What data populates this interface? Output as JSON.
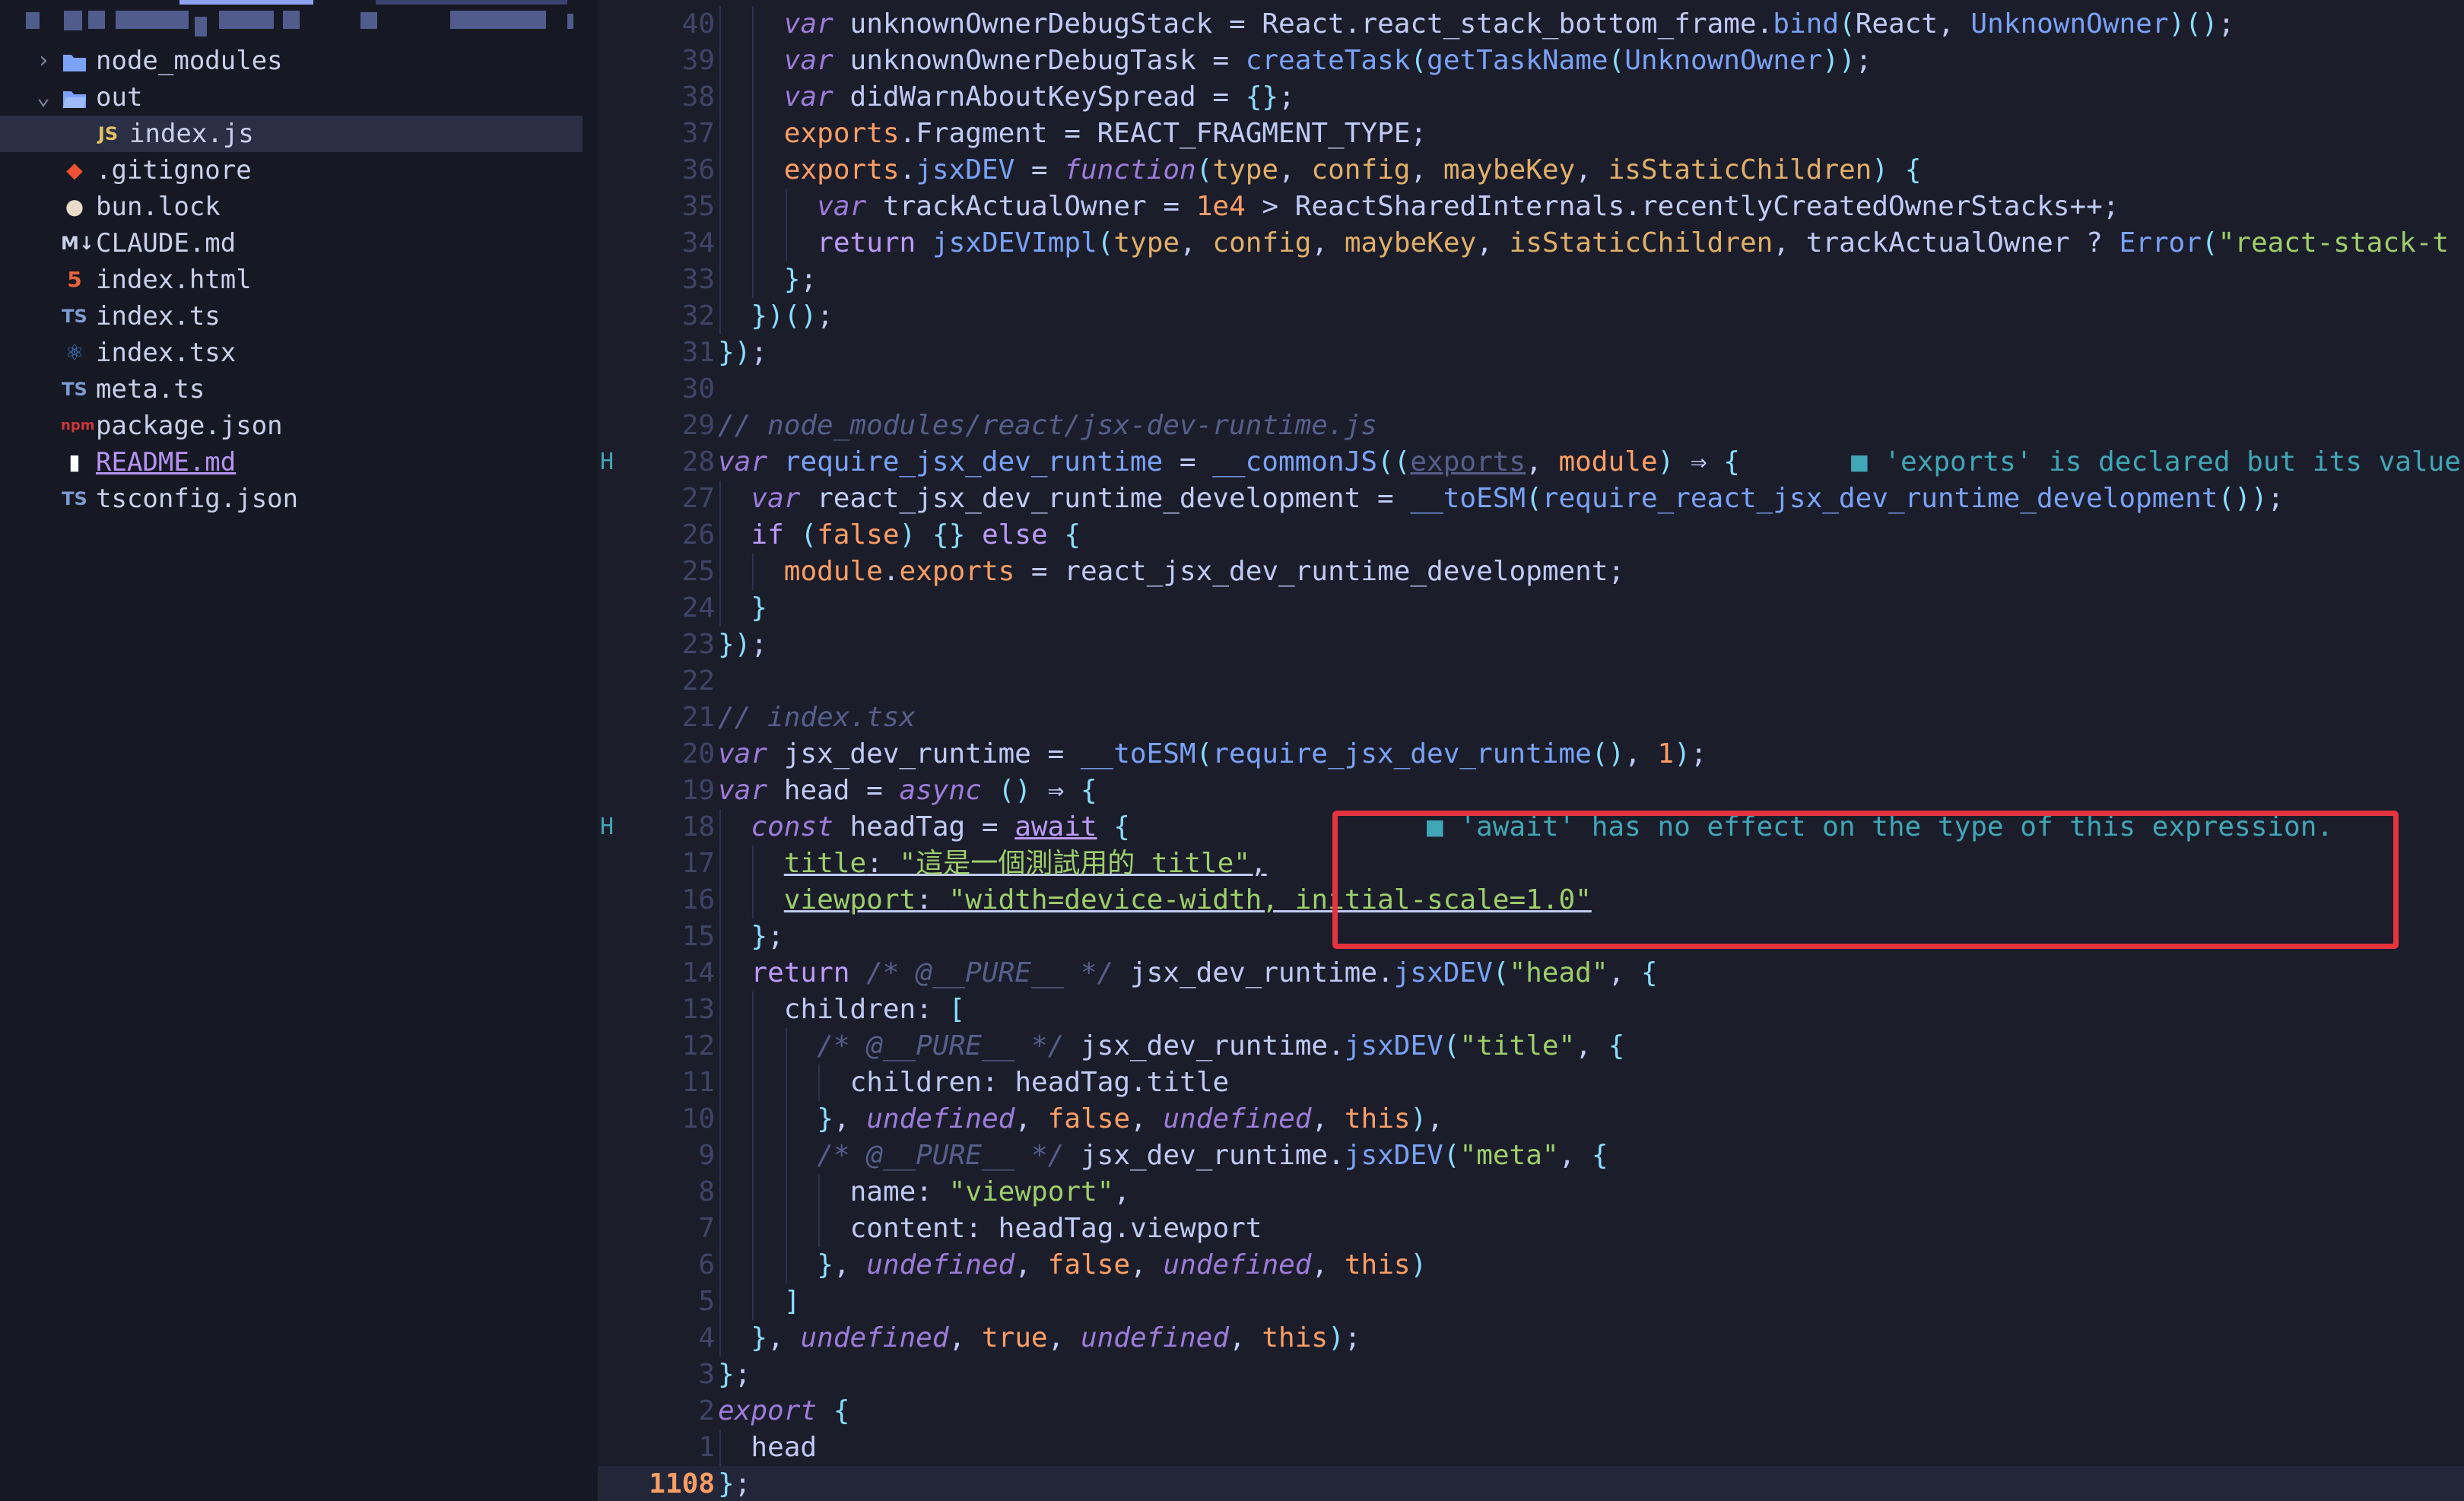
{
  "sidebar": {
    "items": [
      {
        "label": "node_modules",
        "icon": "folder-icon",
        "kind": "folder-closed"
      },
      {
        "label": "out",
        "icon": "folder-open-icon",
        "kind": "folder-open"
      },
      {
        "label": "index.js",
        "icon": "js-file-icon",
        "icon_text": "JS",
        "kind": "file",
        "active": true
      },
      {
        "label": ".gitignore",
        "icon": "git-icon",
        "icon_text": "◆",
        "kind": "file"
      },
      {
        "label": "bun.lock",
        "icon": "bun-icon",
        "icon_text": "●",
        "kind": "file"
      },
      {
        "label": "CLAUDE.md",
        "icon": "markdown-icon",
        "icon_text": "M↓",
        "kind": "file"
      },
      {
        "label": "index.html",
        "icon": "html5-icon",
        "icon_text": "5",
        "kind": "file"
      },
      {
        "label": "index.ts",
        "icon": "typescript-icon",
        "icon_text": "TS",
        "kind": "file"
      },
      {
        "label": "index.tsx",
        "icon": "react-icon",
        "icon_text": "⚛",
        "kind": "file"
      },
      {
        "label": "meta.ts",
        "icon": "typescript-icon",
        "icon_text": "TS",
        "kind": "file"
      },
      {
        "label": "package.json",
        "icon": "npm-icon",
        "icon_text": "npm",
        "kind": "file"
      },
      {
        "label": "README.md",
        "icon": "readme-icon",
        "icon_text": "▮",
        "kind": "file",
        "modified": true
      },
      {
        "label": "tsconfig.json",
        "icon": "tsconfig-icon",
        "icon_text": "TS",
        "kind": "file"
      }
    ]
  },
  "editor": {
    "lines": [
      {
        "num": "40",
        "code": "var unknownOwnerDebugStack = React.react_stack_bottom_frame.bind(React, UnknownOwner)();"
      },
      {
        "num": "39",
        "code": "var unknownOwnerDebugTask = createTask(getTaskName(UnknownOwner));"
      },
      {
        "num": "38",
        "code": "var didWarnAboutKeySpread = {};"
      },
      {
        "num": "37",
        "code": "exports.Fragment = REACT_FRAGMENT_TYPE;"
      },
      {
        "num": "36",
        "code": "exports.jsxDEV = function(type, config, maybeKey, isStaticChildren) {"
      },
      {
        "num": "35",
        "code": "var trackActualOwner = 1e4 > ReactSharedInternals.recentlyCreatedOwnerStacks++;"
      },
      {
        "num": "34",
        "code": "return jsxDEVImpl(type, config, maybeKey, isStaticChildren, trackActualOwner ? Error(\"react-stack-t"
      },
      {
        "num": "33",
        "code": "};"
      },
      {
        "num": "32",
        "code": "})();"
      },
      {
        "num": "31",
        "code": "});"
      },
      {
        "num": "30",
        "code": ""
      },
      {
        "num": "29",
        "code": "// node_modules/react/jsx-dev-runtime.js"
      },
      {
        "num": "28",
        "code": "var require_jsx_dev_runtime = __commonJS((exports, module) ⇒ {"
      },
      {
        "num": "27",
        "code": "var react_jsx_dev_runtime_development = __toESM(require_react_jsx_dev_runtime_development());"
      },
      {
        "num": "26",
        "code": "if (false) {} else {"
      },
      {
        "num": "25",
        "code": "module.exports = react_jsx_dev_runtime_development;"
      },
      {
        "num": "24",
        "code": "}"
      },
      {
        "num": "23",
        "code": "});"
      },
      {
        "num": "22",
        "code": ""
      },
      {
        "num": "21",
        "code": "// index.tsx"
      },
      {
        "num": "20",
        "code": "var jsx_dev_runtime = __toESM(require_jsx_dev_runtime(), 1);"
      },
      {
        "num": "19",
        "code": "var head = async () ⇒ {"
      },
      {
        "num": "18",
        "code": "const headTag = await {"
      },
      {
        "num": "17",
        "code": "title: \"這是一個測試用的 title\","
      },
      {
        "num": "16",
        "code": "viewport: \"width=device-width, initial-scale=1.0\""
      },
      {
        "num": "15",
        "code": "};"
      },
      {
        "num": "14",
        "code": "return /* @__PURE__ */ jsx_dev_runtime.jsxDEV(\"head\", {"
      },
      {
        "num": "13",
        "code": "children: ["
      },
      {
        "num": "12",
        "code": "/* @__PURE__ */ jsx_dev_runtime.jsxDEV(\"title\", {"
      },
      {
        "num": "11",
        "code": "children: headTag.title"
      },
      {
        "num": "10",
        "code": "}, undefined, false, undefined, this),"
      },
      {
        "num": "9",
        "code": "/* @__PURE__ */ jsx_dev_runtime.jsxDEV(\"meta\", {"
      },
      {
        "num": "8",
        "code": "name: \"viewport\","
      },
      {
        "num": "7",
        "code": "content: headTag.viewport"
      },
      {
        "num": "6",
        "code": "}, undefined, false, undefined, this)"
      },
      {
        "num": "5",
        "code": "]"
      },
      {
        "num": "4",
        "code": "}, undefined, true, undefined, this);"
      },
      {
        "num": "3",
        "code": "};"
      },
      {
        "num": "2",
        "code": "export {"
      },
      {
        "num": "1",
        "code": "head"
      },
      {
        "num": "1108",
        "code": "};"
      }
    ],
    "git_marker": "H",
    "diagnostics": {
      "exports_unused": "'exports' is declared but its value",
      "await_no_effect": "'await' has no effect on the type of this expression."
    },
    "highlight_color": "#e5343d"
  }
}
